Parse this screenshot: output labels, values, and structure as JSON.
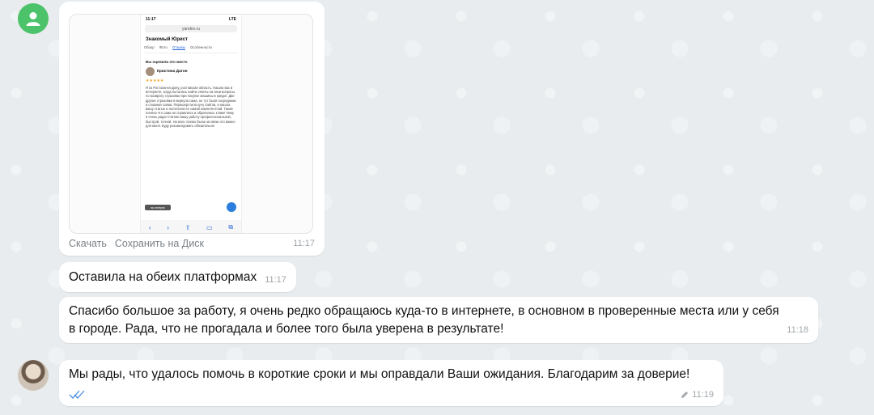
{
  "messages": {
    "image_message": {
      "actions": [
        "Скачать",
        "Сохранить на Диск"
      ],
      "time": "11:17",
      "screenshot": {
        "status_time": "11:17",
        "status_right": "LTE",
        "url": "yandex.ru",
        "title": "Знакомый Юрист",
        "tabs": [
          "Обзор",
          "Фото",
          "Отзывы",
          "Особенности"
        ],
        "section": "Вы оценили это место",
        "reviewer": "Кристина Дагон",
        "stars": "★★★★★",
        "review_text": "Я из Ростова-на-Дону, ростовская область. Нашла вас в интернете, когда пыталась найти ответы на свои вопросы по возврату страховки при покупке машины в кредит. Две другие страховки я вернула сама, но тут были посредники и сложная схема. Перешерстила кучу сайтов, и нашла вашу статью и посчитала ее самой компетентной. Также поняла что сама не справлюсь и обратилась к вам! Чему я очень рада! Считаю вашу работу профессиональной, быстрой, точной. На всех этапах была на связи это важно для меня. Буду рекомендовать обязательно!",
        "chip": "на интерес"
      }
    },
    "message_2": {
      "text": "Оставила на обеих платформах",
      "time": "11:17"
    },
    "message_3": {
      "text": "Спасибо большое за работу, я очень редко обращаюсь куда-то в интернете, в основном в проверенные места или у себя в городе. Рада, что не прогадала и более того была уверена в результате!",
      "time": "11:18"
    },
    "message_4": {
      "text": "Мы рады, что удалось помочь в короткие сроки и мы оправдали Ваши ожидания. Благодарим за доверие!",
      "time": "11:19"
    }
  },
  "colors": {
    "background": "#e8ecef",
    "bubble": "#ffffff",
    "avatar": "#4cc26a",
    "ticks": "#4a8fe0"
  },
  "icons": [
    "user-icon",
    "read-ticks-icon",
    "edit-pencil-icon"
  ]
}
